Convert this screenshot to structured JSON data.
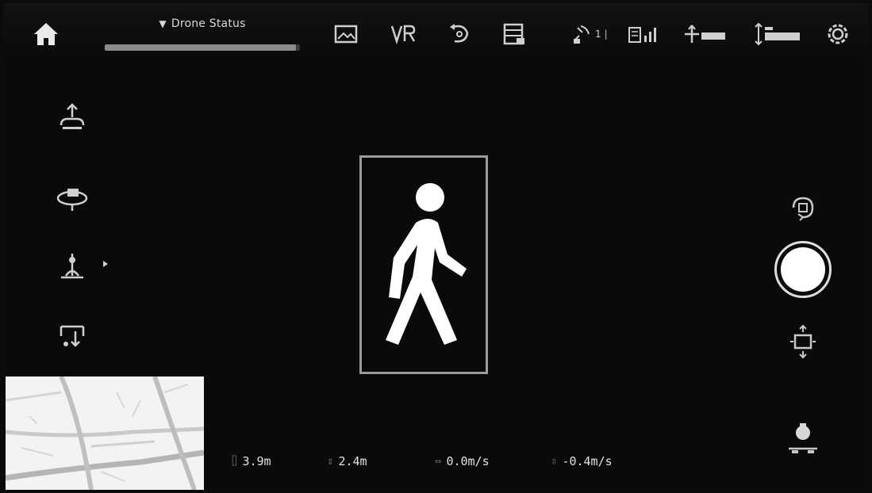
{
  "topbar": {
    "status_label": "Drone Status",
    "status_progress": 0.98,
    "tools": [
      "gallery-icon",
      "vr-icon",
      "return-icon",
      "checklist-icon"
    ],
    "telemetry": [
      {
        "icon": "gps-satellite-icon",
        "value": "1"
      },
      {
        "icon": "remote-signal-icon",
        "value": ""
      },
      {
        "icon": "distance-icon",
        "value": ""
      },
      {
        "icon": "altitude-icon",
        "value": ""
      }
    ],
    "settings_icon": "gear-icon"
  },
  "left_controls": [
    "takeoff-icon",
    "follow-mode-icon",
    "flight-mode-icon",
    "landing-icon"
  ],
  "tracker": {
    "icon": "walking-person-icon"
  },
  "right_controls": [
    "camera-mode-icon",
    "shutter-button",
    "gimbal-icon",
    "camera-settings-icon"
  ],
  "bottom_telemetry": [
    {
      "icon": "distance-icon",
      "label": "3.9m"
    },
    {
      "icon": "height-icon",
      "label": "2.4m"
    },
    {
      "icon": "horizontal-speed-icon",
      "label": "0.0m/s"
    },
    {
      "icon": "vertical-speed-icon",
      "label": "-0.4m/s"
    }
  ],
  "colors": {
    "background": "#0a0a0a",
    "tracker_border": "#9b9b9b",
    "icon": "#d0d0d0"
  }
}
